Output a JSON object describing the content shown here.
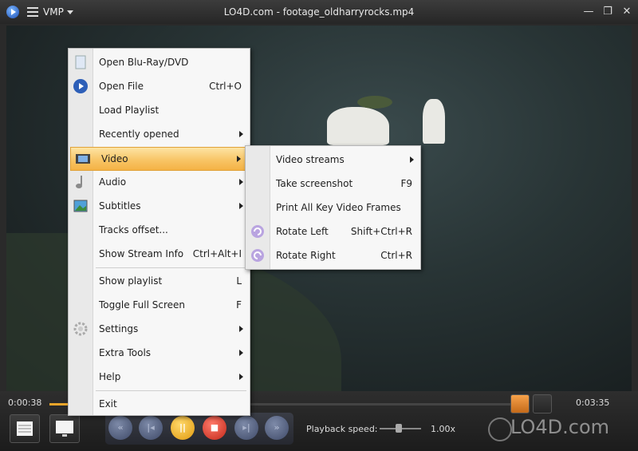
{
  "window": {
    "menu_label": "VMP",
    "title": "LO4D.com - footage_oldharryrocks.mp4",
    "minimize": "—",
    "restore": "❐",
    "close": "✕"
  },
  "main_menu": [
    {
      "label": "Open Blu-Ray/DVD",
      "shortcut": "",
      "submenu": false,
      "icon": "disc-icon"
    },
    {
      "label": "Open File",
      "shortcut": "Ctrl+O",
      "submenu": false,
      "icon": "play-circle-icon"
    },
    {
      "label": "Load Playlist",
      "shortcut": "",
      "submenu": false,
      "icon": ""
    },
    {
      "label": "Recently opened",
      "shortcut": "",
      "submenu": true,
      "icon": ""
    },
    {
      "label": "Video",
      "shortcut": "",
      "submenu": true,
      "icon": "film-icon",
      "highlighted": true
    },
    {
      "label": "Audio",
      "shortcut": "",
      "submenu": true,
      "icon": "music-note-icon"
    },
    {
      "label": "Subtitles",
      "shortcut": "",
      "submenu": true,
      "icon": "picture-icon"
    },
    {
      "label": "Tracks offset...",
      "shortcut": "",
      "submenu": false,
      "icon": ""
    },
    {
      "label": "Show Stream Info",
      "shortcut": "Ctrl+Alt+I",
      "submenu": false,
      "icon": ""
    },
    {
      "label": "Show playlist",
      "shortcut": "L",
      "submenu": false,
      "icon": ""
    },
    {
      "label": "Toggle Full Screen",
      "shortcut": "F",
      "submenu": false,
      "icon": ""
    },
    {
      "label": "Settings",
      "shortcut": "",
      "submenu": true,
      "icon": "gear-icon"
    },
    {
      "label": "Extra Tools",
      "shortcut": "",
      "submenu": true,
      "icon": ""
    },
    {
      "label": "Help",
      "shortcut": "",
      "submenu": true,
      "icon": ""
    },
    {
      "label": "Exit",
      "shortcut": "",
      "submenu": false,
      "icon": ""
    }
  ],
  "video_submenu": [
    {
      "label": "Video streams",
      "shortcut": "",
      "submenu": true,
      "icon": ""
    },
    {
      "label": "Take screenshot",
      "shortcut": "F9",
      "submenu": false,
      "icon": ""
    },
    {
      "label": "Print All Key Video Frames",
      "shortcut": "",
      "submenu": false,
      "icon": ""
    },
    {
      "label": "Rotate Left",
      "shortcut": "Shift+Ctrl+R",
      "submenu": false,
      "icon": "rotate-left-icon"
    },
    {
      "label": "Rotate Right",
      "shortcut": "Ctrl+R",
      "submenu": false,
      "icon": "rotate-right-icon"
    }
  ],
  "playback": {
    "current_time": "0:00:38",
    "total_time": "0:03:35",
    "progress_fraction": 0.18,
    "speed_label": "Playback speed:",
    "speed_value": "1.00x"
  },
  "transport": {
    "prev_label": "«",
    "stop_prev_label": "|◂",
    "pause_label": "||",
    "stop_label": "■",
    "next_label": "▸|",
    "fwd_label": "»"
  },
  "watermark": "LO4D.com",
  "colors": {
    "highlight": "#f8c566",
    "seek_fill": "#e8a52a",
    "pause_button": "#f2b21c",
    "stop_button": "#d23a2a"
  }
}
